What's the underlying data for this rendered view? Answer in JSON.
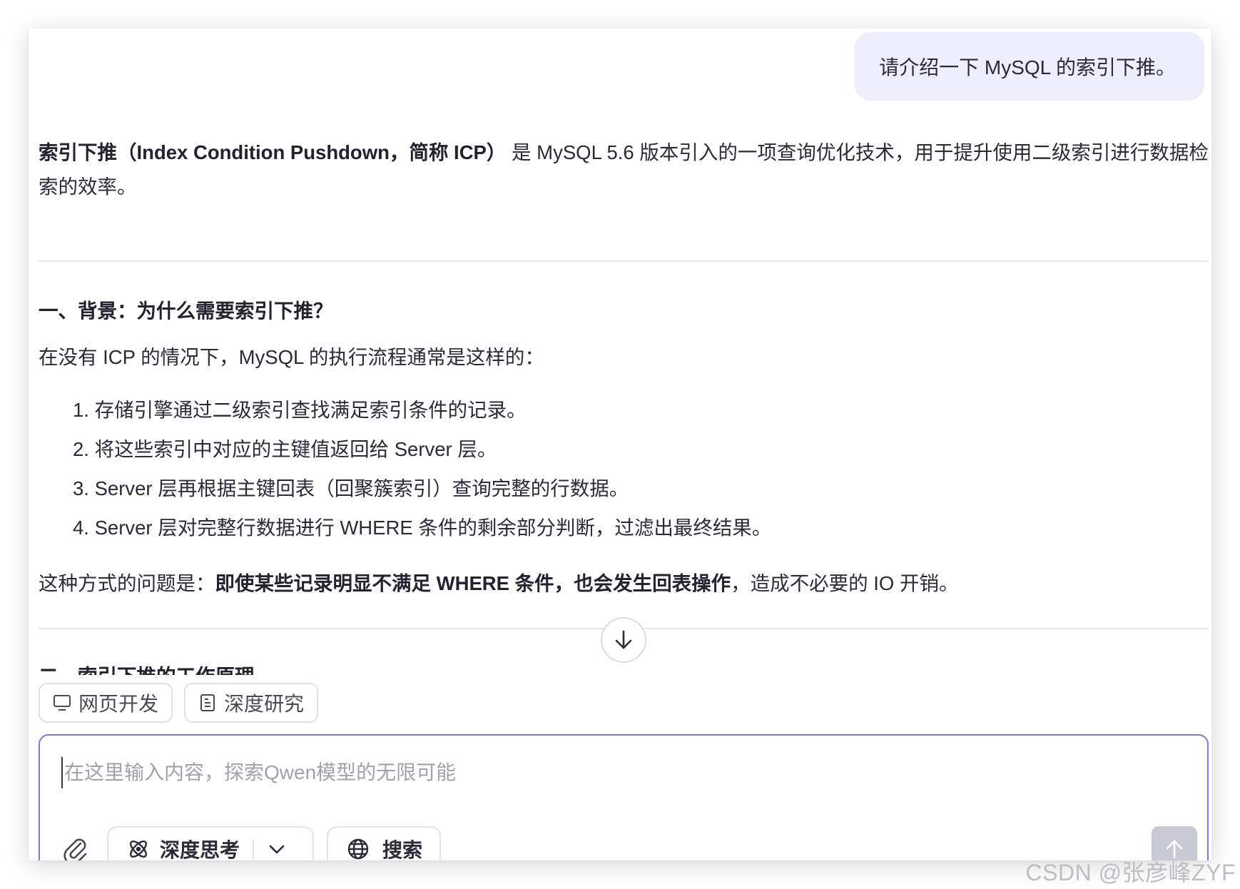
{
  "user_message": "请介绍一下 MySQL 的索引下推。",
  "answer": {
    "intro_bold": "索引下推（Index Condition Pushdown，简称 ICP）",
    "intro_rest_1": " 是 MySQL 5.6 版本引入的一项查询优化技术，用于提升使用二级索引进行数据检",
    "intro_rest_2": "索的效率。",
    "section1_heading": "一、背景：为什么需要索引下推？",
    "section1_text": "在没有 ICP 的情况下，MySQL 的执行流程通常是这样的：",
    "steps": [
      "1. 存储引擎通过二级索引查找满足索引条件的记录。",
      "2. 将这些索引中对应的主键值返回给 Server 层。",
      "3. Server 层再根据主键回表（回聚簇索引）查询完整的行数据。",
      "4. Server 层对完整行数据进行 WHERE 条件的剩余部分判断，过滤出最终结果。"
    ],
    "problem_prefix": "这种方式的问题是：",
    "problem_bold": "即使某些记录明显不满足 WHERE 条件，也会发生回表操作",
    "problem_suffix": "，造成不必要的 IO 开销。",
    "section2_heading_partial": "二、索引下推的工作原理"
  },
  "chips": {
    "web_dev": "网页开发",
    "deep_research": "深度研究"
  },
  "composer": {
    "placeholder": "在这里输入内容，探索Qwen模型的无限可能",
    "value": "",
    "deep_think_label": "深度思考",
    "search_label": "搜索"
  },
  "icons": {
    "attach": "paperclip-icon",
    "deep_think": "atom-icon",
    "dropdown": "chevron-down-icon",
    "search": "globe-icon",
    "send": "arrow-up-icon",
    "scroll": "arrow-down-icon",
    "web_dev": "monitor-icon",
    "research": "document-icon"
  },
  "colors": {
    "accent": "#7f74f0",
    "user_bubble": "#eeedfb",
    "send_disabled": "#c9c9d6"
  },
  "watermark": "CSDN @张彦峰ZYF"
}
